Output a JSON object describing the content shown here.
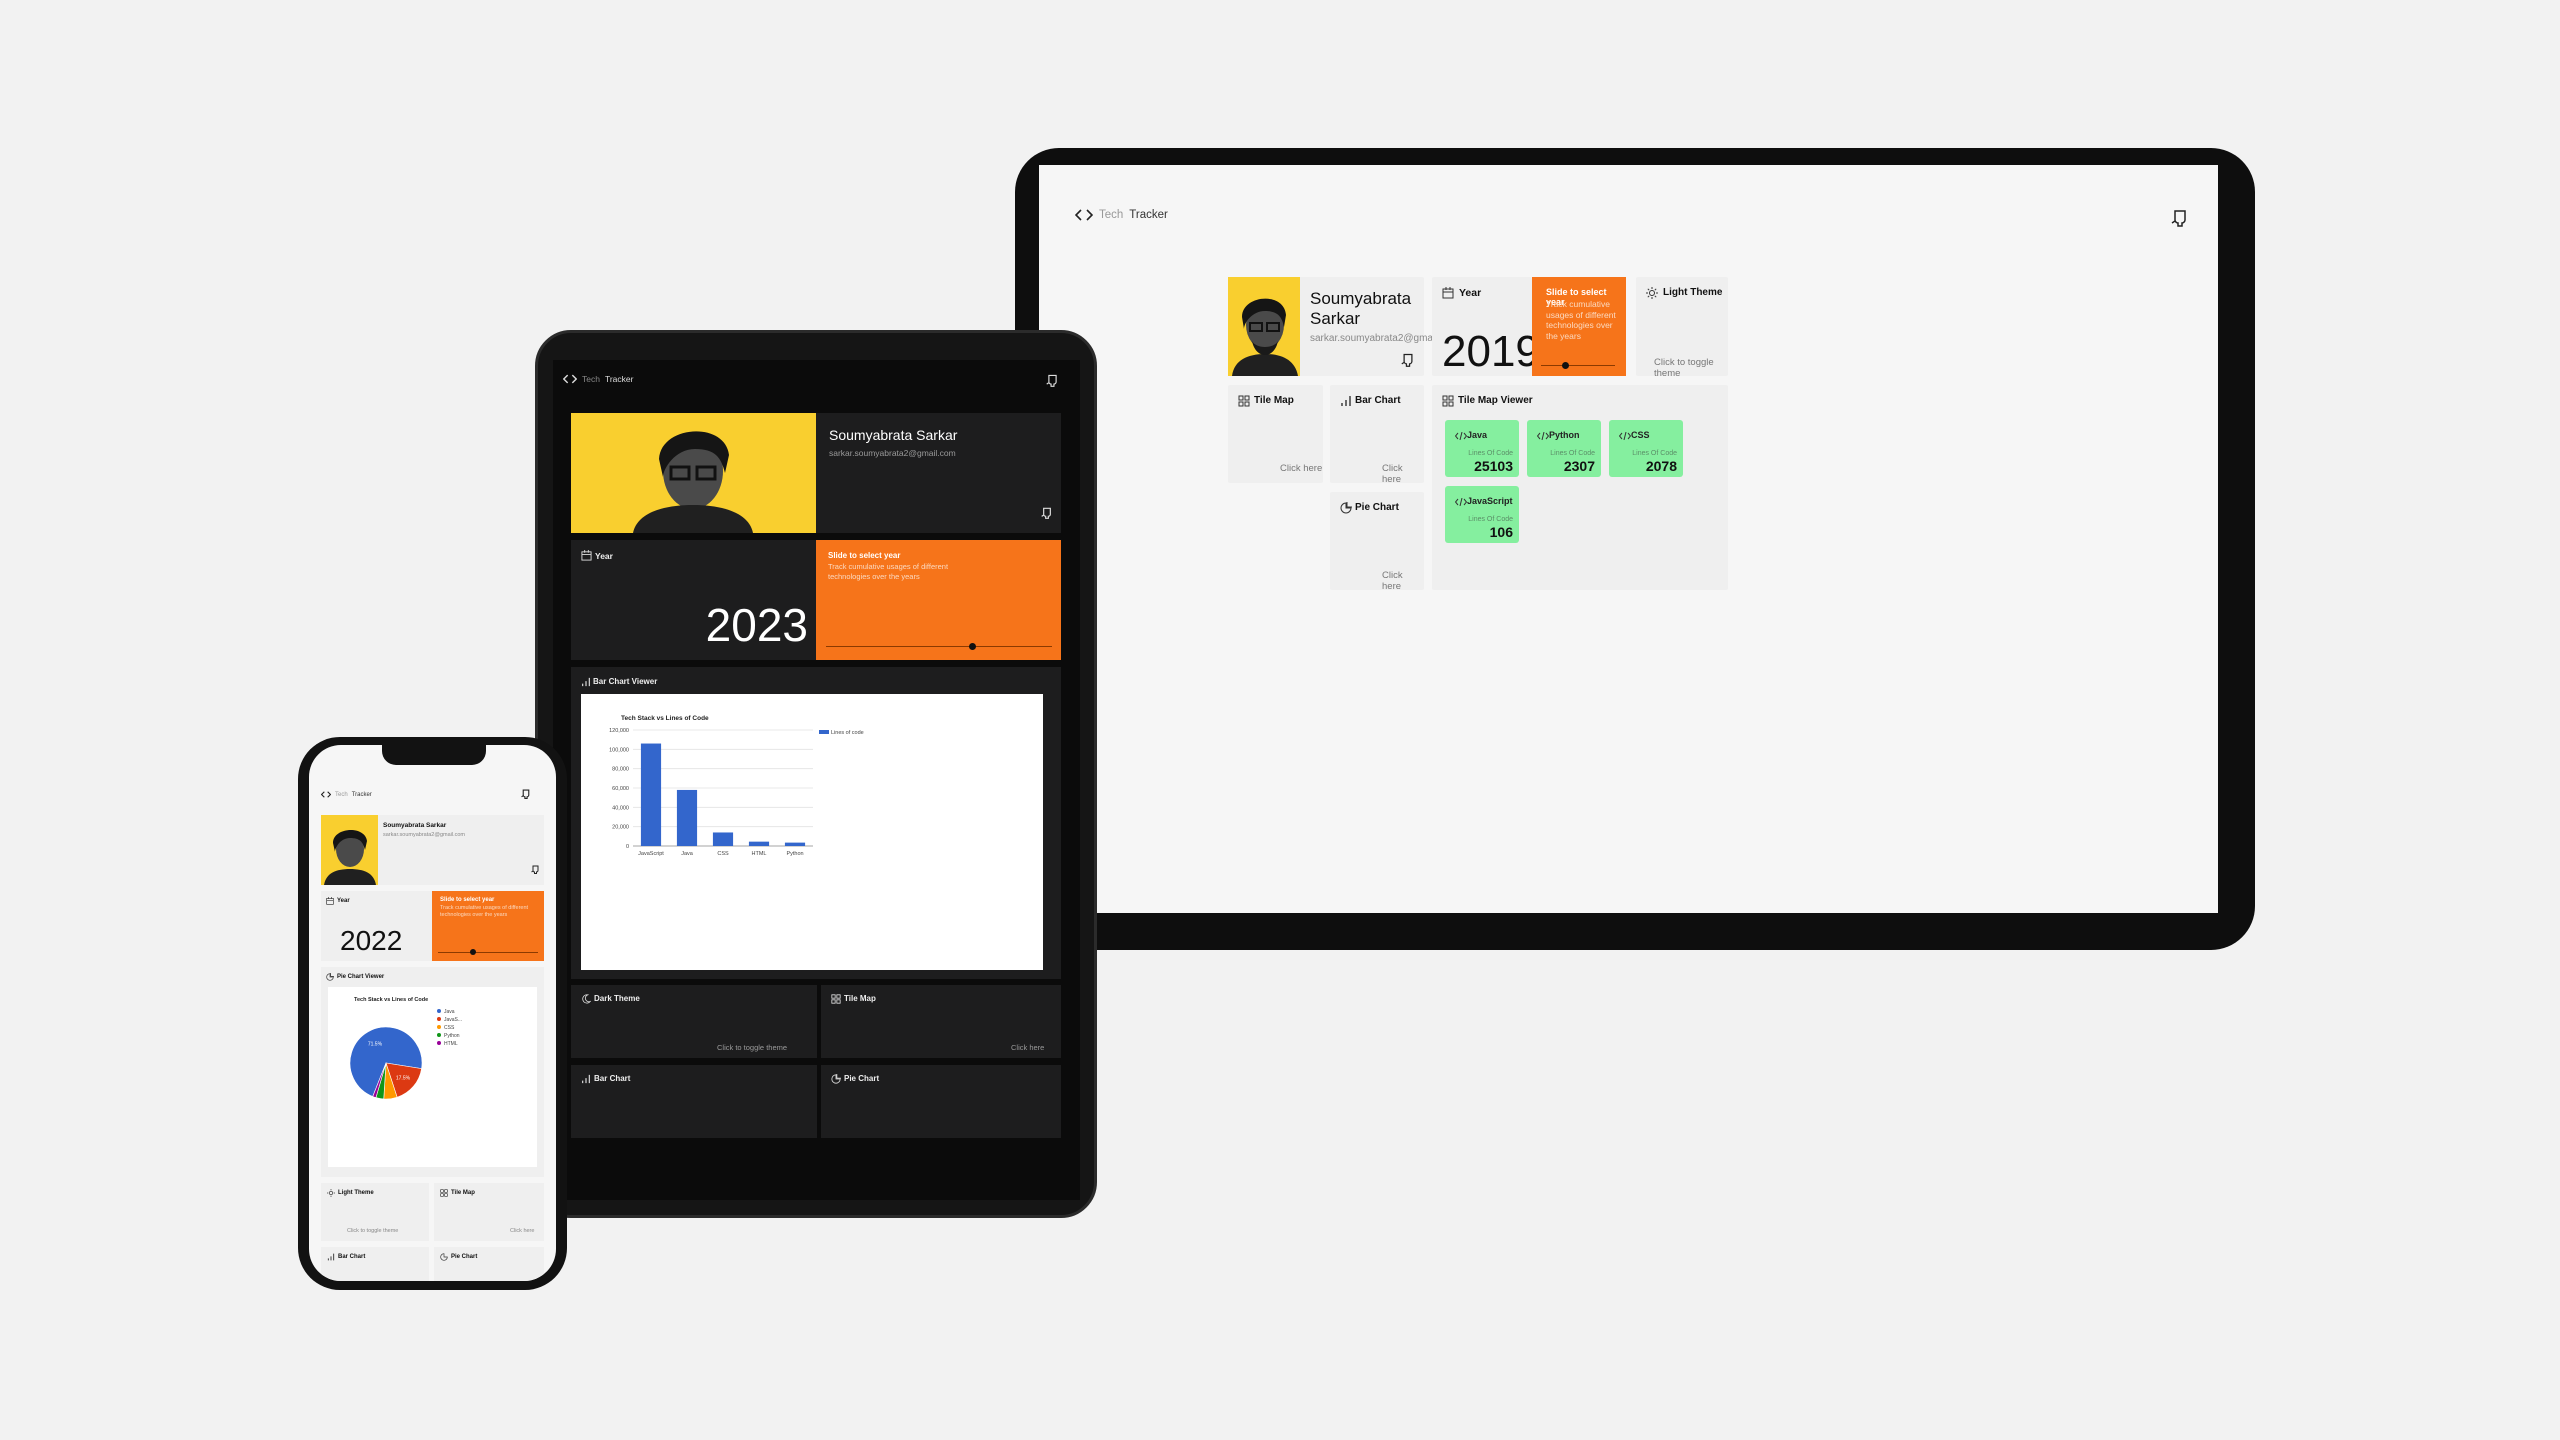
{
  "brand": {
    "prefix": "Tech",
    "name": "Tracker"
  },
  "profile": {
    "name": "Soumyabrata Sarkar",
    "name_line1": "Soumyabrata",
    "name_line2": "Sarkar",
    "email": "sarkar.soumyabrata2@gmail.com"
  },
  "slider": {
    "title": "Slide to select year",
    "desc": "Track cumulative usages of different technologies over the years"
  },
  "year_label": "Year",
  "laptop": {
    "year": "2019",
    "year_slider_fraction": 0.33,
    "theme": {
      "title": "Light Theme",
      "sub": "Click to toggle theme"
    },
    "tile_map": {
      "title": "Tile Map",
      "sub": "Click here"
    },
    "bar_chart": {
      "title": "Bar Chart",
      "sub": "Click here"
    },
    "pie_chart": {
      "title": "Pie Chart",
      "sub": "Click here"
    },
    "viewer_title": "Tile Map Viewer",
    "tiles": [
      {
        "name": "Java",
        "label": "Lines Of Code",
        "value": "25103"
      },
      {
        "name": "Python",
        "label": "Lines Of Code",
        "value": "2307"
      },
      {
        "name": "CSS",
        "label": "Lines Of Code",
        "value": "2078"
      },
      {
        "name": "JavaScript",
        "label": "Lines Of Code",
        "value": "106"
      }
    ],
    "colors": {
      "accent": "#f6741a",
      "tile": "#85ef9f",
      "photo_bg": "#f9cf2f"
    }
  },
  "tablet": {
    "year": "2023",
    "year_slider_fraction": 0.65,
    "viewer_title": "Bar Chart Viewer",
    "dark_theme": {
      "title": "Dark Theme",
      "sub": "Click to toggle theme"
    },
    "tile_map": {
      "title": "Tile Map",
      "sub": "Click here"
    },
    "bar_chart": {
      "title": "Bar Chart"
    },
    "pie_chart": {
      "title": "Pie Chart"
    }
  },
  "phone": {
    "year": "2022",
    "year_slider_fraction": 0.35,
    "viewer_title": "Pie Chart Viewer",
    "light_theme": {
      "title": "Light Theme",
      "sub": "Click to toggle theme"
    },
    "tile_map": {
      "title": "Tile Map",
      "sub": "Click here"
    },
    "bar_chart": {
      "title": "Bar Chart"
    },
    "pie_chart": {
      "title": "Pie Chart"
    }
  },
  "chart_data": [
    {
      "type": "bar",
      "title": "Tech Stack vs Lines of Code",
      "categories": [
        "JavaScript",
        "Java",
        "CSS",
        "HTML",
        "Python"
      ],
      "series": [
        {
          "name": "Lines of code",
          "values": [
            106000,
            58000,
            14000,
            4500,
            3500
          ],
          "color": "#3366cc"
        }
      ],
      "ylim": [
        0,
        120000
      ],
      "yticks": [
        "0",
        "20,000",
        "40,000",
        "60,000",
        "80,000",
        "100,000",
        "120,000"
      ],
      "legend": "right",
      "grid": true
    },
    {
      "type": "pie",
      "title": "Tech Stack vs Lines of Code",
      "categories": [
        "Java",
        "JavaS...",
        "CSS",
        "Python",
        "HTML"
      ],
      "values": [
        71.5,
        17.5,
        6,
        3.5,
        1.5
      ],
      "slice_labels": [
        "71.5%",
        "17.5%",
        "",
        "",
        ""
      ],
      "colors": [
        "#3366cc",
        "#dc3912",
        "#ff9900",
        "#109618",
        "#990099"
      ],
      "legend": "right"
    }
  ]
}
